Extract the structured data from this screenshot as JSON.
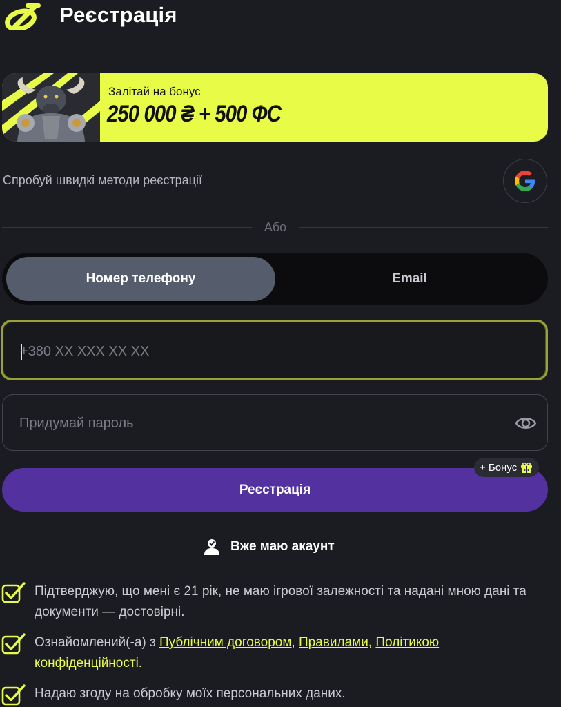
{
  "header": {
    "title": "Реєстрація",
    "logo_icon": "brand-logo-icon"
  },
  "banner": {
    "line1": "Залітай на бонус",
    "line2": "250 000 ₴ + 500 ФС",
    "bg_color": "#e8fb47"
  },
  "quick_signup": {
    "text": "Спробуй швидкі методи реєстрації",
    "google_icon": "google-icon"
  },
  "divider": {
    "text": "Або"
  },
  "tabs": [
    {
      "label": "Номер телефону",
      "active": true
    },
    {
      "label": "Email",
      "active": false
    }
  ],
  "phone": {
    "placeholder": "+380 XX XXX XX XX",
    "value": ""
  },
  "password": {
    "placeholder": "Придумай пароль",
    "value": "",
    "toggle_icon": "eye-icon"
  },
  "register": {
    "label": "Реєстрація",
    "bonus_label": "+ Бонус",
    "bonus_icon": "gift-icon",
    "color": "#5332a0"
  },
  "login": {
    "label": "Вже маю акаунт",
    "icon": "user-check-icon"
  },
  "agreements": {
    "age": "Підтверджую, що мені є 21 рік, не маю ігрової залежності та надані мною дані та документи — достовірні.",
    "terms_prefix": "Ознайомлений(-а) з",
    "terms_link1": "Публічним договором,",
    "terms_link2": "Правилами,",
    "terms_link3": "Політикою конфіденційності.",
    "consent": "Надаю згоду на обробку моїх персональних даних."
  },
  "accent_color": "#e8fb47"
}
